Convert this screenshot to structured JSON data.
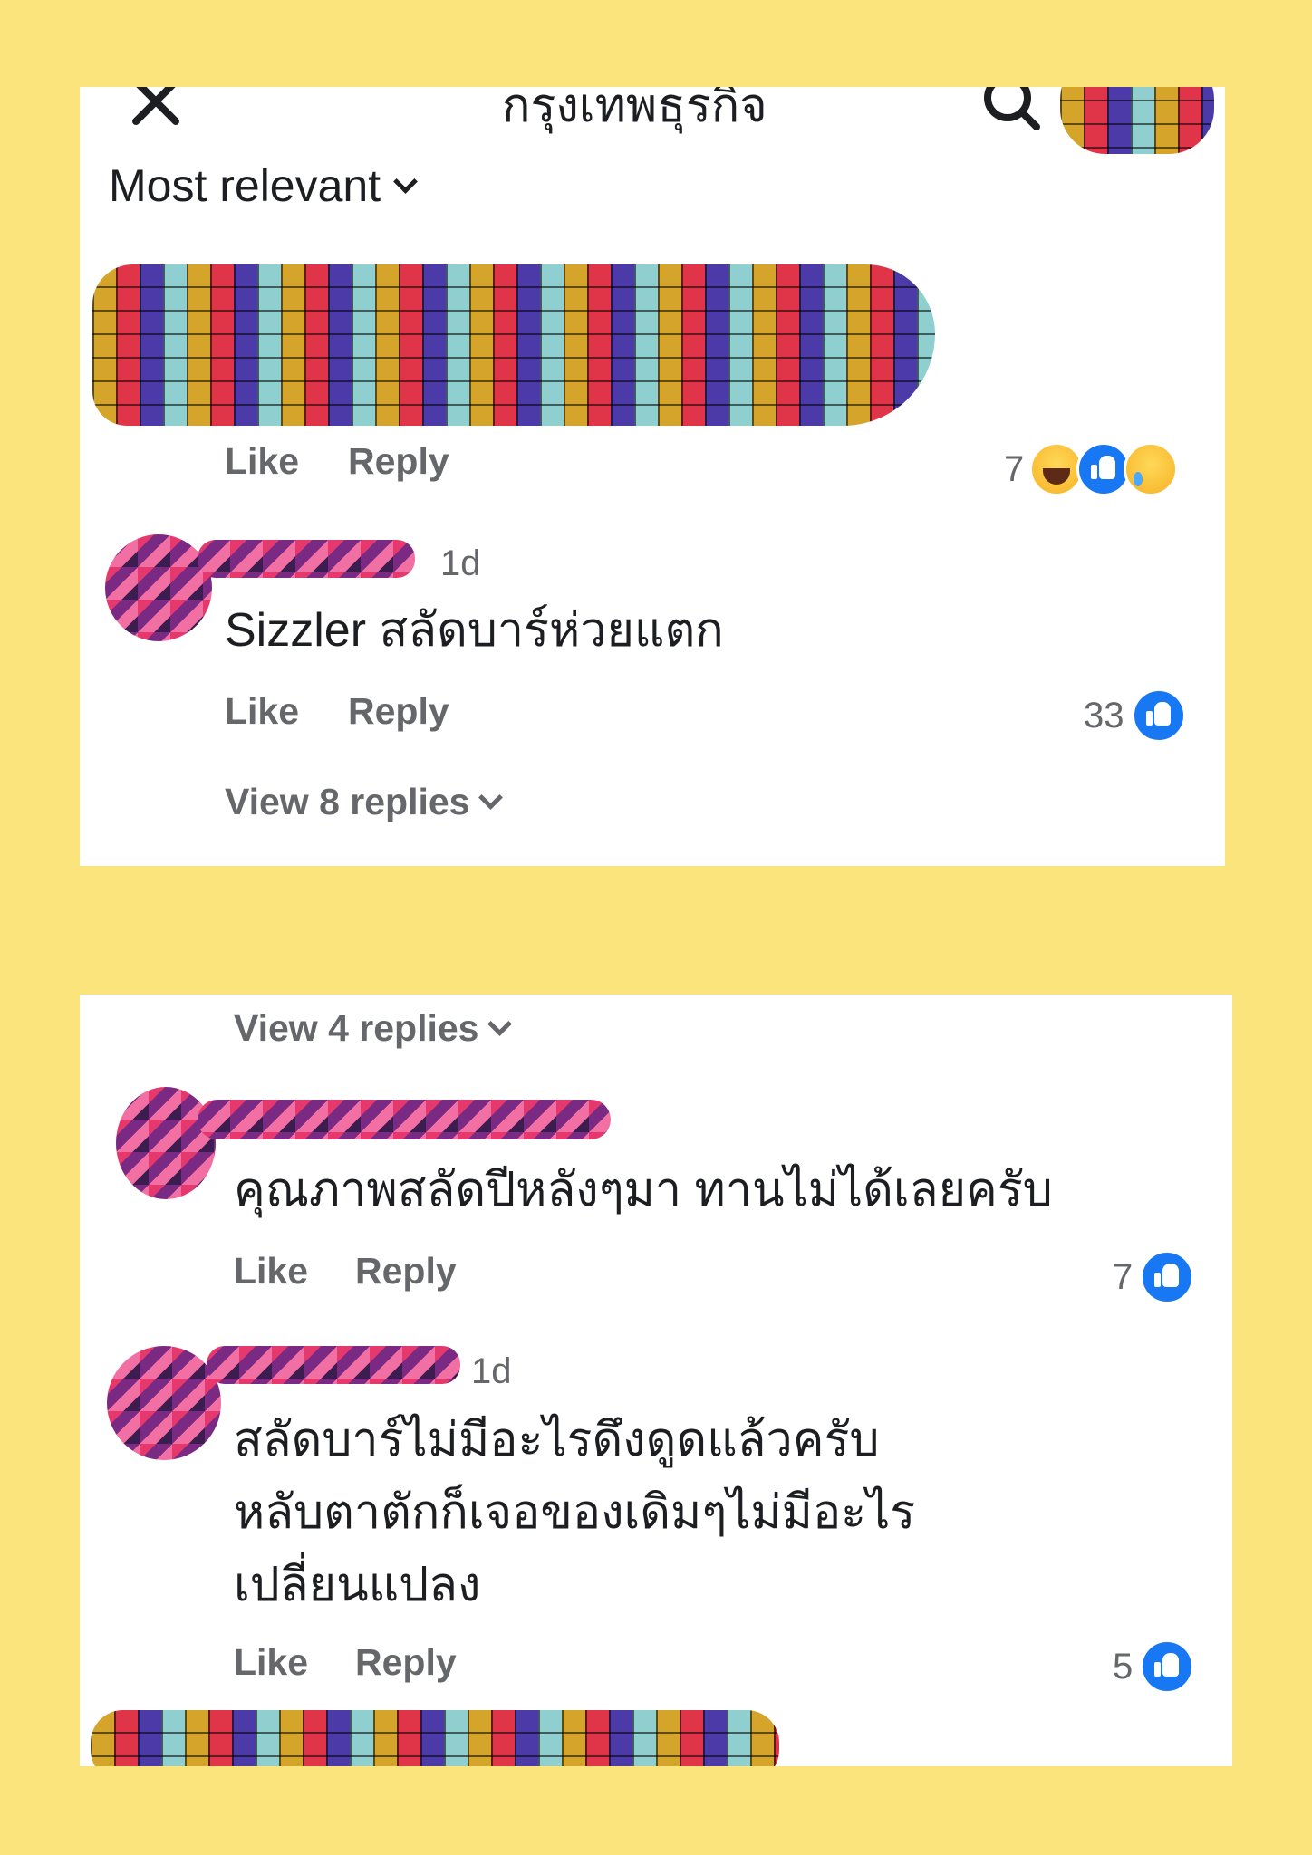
{
  "header": {
    "page_name": "กรุงเทพธุรกิจ",
    "close_icon": "close-icon",
    "search_icon": "search-icon"
  },
  "sort": {
    "label": "Most relevant"
  },
  "actions": {
    "like": "Like",
    "reply": "Reply"
  },
  "comments_top": [
    {
      "reaction_count": "7",
      "reactions": [
        "haha-icon",
        "like-icon",
        "sad-icon"
      ]
    },
    {
      "time": "1d",
      "text": "Sizzler สลัดบาร์ห่วยแตก",
      "reaction_count": "33",
      "view_replies": "View 8 replies"
    }
  ],
  "comments_bottom": [
    {
      "view_replies": "View 4 replies"
    },
    {
      "text": "คุณภาพสลัดปีหลังๆมา ทานไม่ได้เลยครับ",
      "reaction_count": "7"
    },
    {
      "time": "1d",
      "text": "สลัดบาร์ไม่มีอะไรดึงดูดแล้วครับ\nหลับตาตักก็เจอของเดิมๆไม่มีอะไร\nเปลี่ยนแปลง",
      "reaction_count": "5"
    }
  ],
  "colors": {
    "background": "#fbe47c",
    "panel": "#ffffff",
    "secondary_text": "#65676b",
    "like_blue": "#1877f2"
  }
}
